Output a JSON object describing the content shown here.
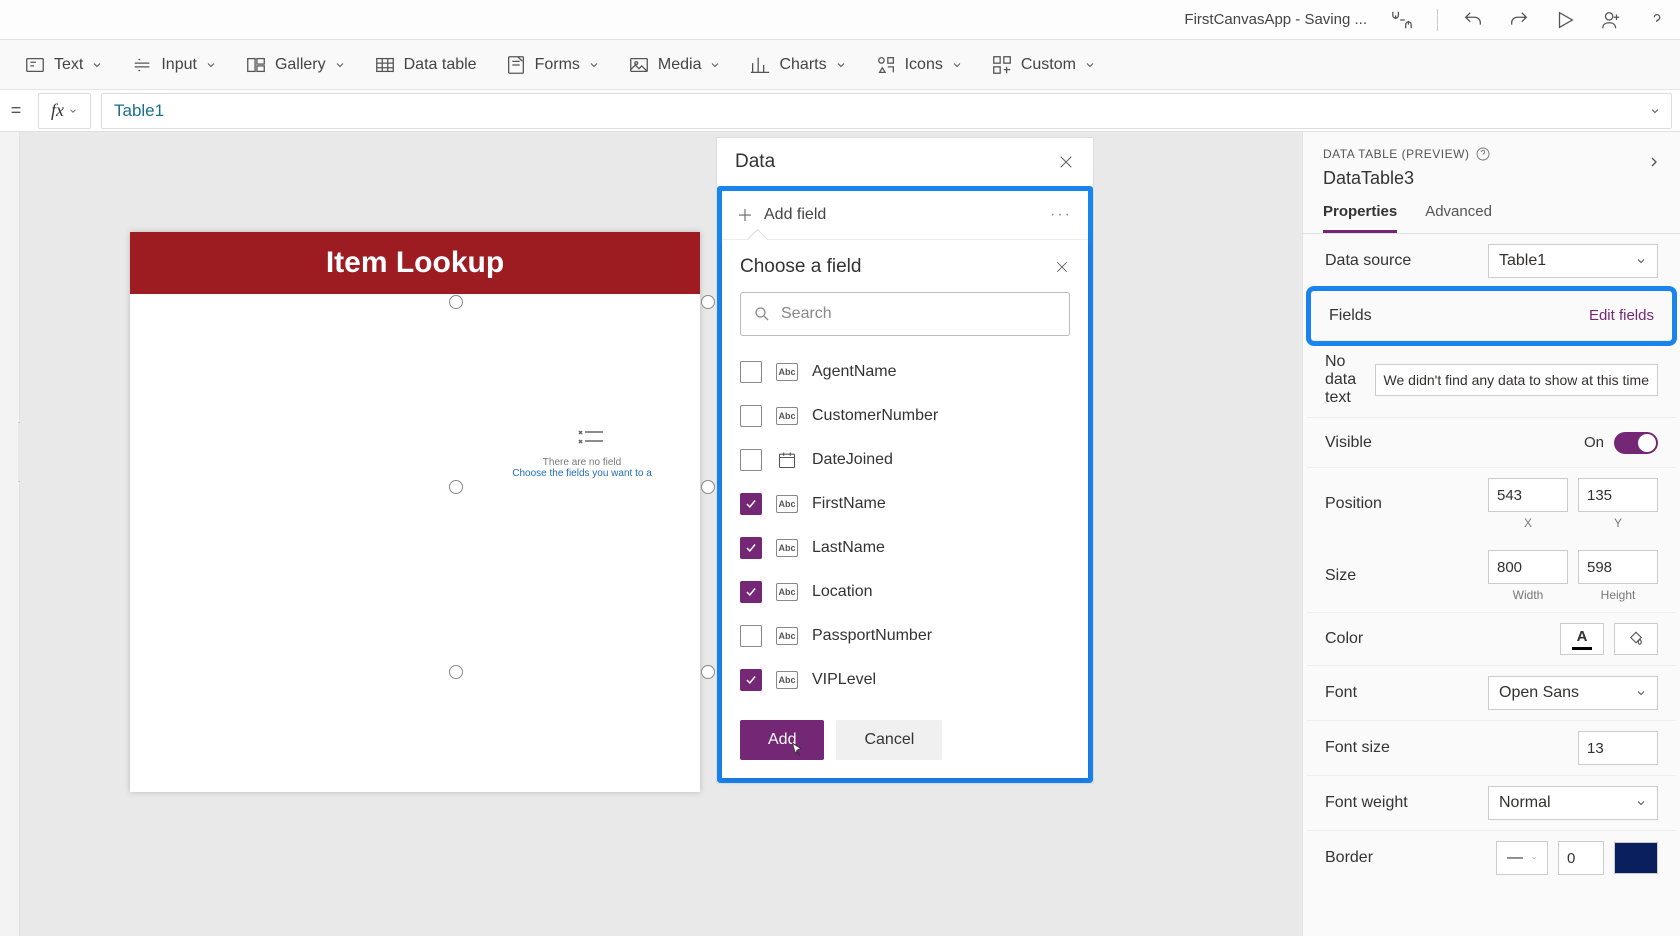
{
  "titlebar": {
    "title": "FirstCanvasApp - Saving ..."
  },
  "ribbon": {
    "text": "Text",
    "input": "Input",
    "gallery": "Gallery",
    "datatable": "Data table",
    "forms": "Forms",
    "media": "Media",
    "charts": "Charts",
    "icons": "Icons",
    "custom": "Custom"
  },
  "formulabar": {
    "eq": "=",
    "fx": "fx",
    "value": "Table1"
  },
  "canvas": {
    "header": "Item Lookup",
    "placeholder1": "There are no field",
    "placeholder2": "Choose the fields you want to a"
  },
  "datapanel": {
    "title": "Data",
    "addfield": "Add field",
    "choose": "Choose a field",
    "search_placeholder": "Search",
    "abc": "Abc",
    "fields": [
      {
        "name": "AgentName",
        "type": "text",
        "checked": false
      },
      {
        "name": "CustomerNumber",
        "type": "text",
        "checked": false
      },
      {
        "name": "DateJoined",
        "type": "date",
        "checked": false
      },
      {
        "name": "FirstName",
        "type": "text",
        "checked": true
      },
      {
        "name": "LastName",
        "type": "text",
        "checked": true
      },
      {
        "name": "Location",
        "type": "text",
        "checked": true
      },
      {
        "name": "PassportNumber",
        "type": "text",
        "checked": false
      },
      {
        "name": "VIPLevel",
        "type": "text",
        "checked": true
      }
    ],
    "add_btn": "Add",
    "cancel_btn": "Cancel"
  },
  "proppanel": {
    "category": "DATA TABLE (PREVIEW)",
    "name": "DataTable3",
    "tab_props": "Properties",
    "tab_adv": "Advanced",
    "props": {
      "datasource_lbl": "Data source",
      "datasource_val": "Table1",
      "fields_lbl": "Fields",
      "fields_link": "Edit fields",
      "nodata_lbl": "No data text",
      "nodata_val": "We didn't find any data to show at this time",
      "visible_lbl": "Visible",
      "visible_on": "On",
      "position_lbl": "Position",
      "pos_x": "543",
      "pos_y": "135",
      "x": "X",
      "y": "Y",
      "size_lbl": "Size",
      "w": "800",
      "h": "598",
      "wl": "Width",
      "hl": "Height",
      "color_lbl": "Color",
      "font_lbl": "Font",
      "font_val": "Open Sans",
      "fontsize_lbl": "Font size",
      "fontsize_val": "13",
      "fontweight_lbl": "Font weight",
      "fontweight_val": "Normal",
      "border_lbl": "Border",
      "border_val": "0"
    }
  }
}
